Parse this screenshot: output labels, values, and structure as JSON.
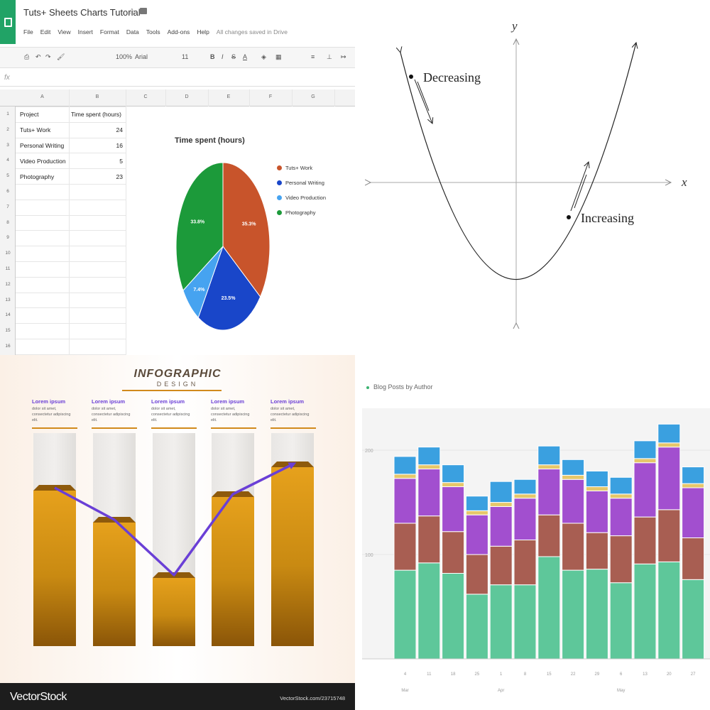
{
  "spreadsheet": {
    "title": "Tuts+ Sheets Charts Tutorial",
    "menu": [
      "File",
      "Edit",
      "View",
      "Insert",
      "Format",
      "Data",
      "Tools",
      "Add-ons",
      "Help"
    ],
    "saved_status": "All changes saved in Drive",
    "toolbar": {
      "zoom": "100%",
      "font": "Arial",
      "size": "11",
      "bold": "B",
      "italic": "I",
      "strike": "S",
      "text_color": "A"
    },
    "fx_label": "fx",
    "columns": [
      "A",
      "B",
      "C",
      "D",
      "E",
      "F",
      "G"
    ],
    "rows": [
      "1",
      "2",
      "3",
      "4",
      "5",
      "6",
      "7",
      "8",
      "9",
      "10",
      "11",
      "12",
      "13",
      "14",
      "15",
      "16"
    ],
    "headers": {
      "project": "Project",
      "time": "Time spent (hours)"
    },
    "data_rows": [
      {
        "project": "Tuts+ Work",
        "hours": "24"
      },
      {
        "project": "Personal Writing",
        "hours": "16"
      },
      {
        "project": "Video Production",
        "hours": "5"
      },
      {
        "project": "Photography",
        "hours": "23"
      }
    ]
  },
  "chart_data": [
    {
      "type": "pie",
      "title": "Time spent (hours)",
      "labels": [
        "Tuts+ Work",
        "Personal Writing",
        "Video Production",
        "Photography"
      ],
      "values": [
        24,
        16,
        5,
        23
      ],
      "slice_labels": [
        "35.3%",
        "23.5%",
        "7.4%",
        "33.8%"
      ],
      "colors": [
        "#c8542b",
        "#1946c9",
        "#46a3f0",
        "#1c9a3a"
      ],
      "legend_position": "right"
    },
    {
      "type": "line",
      "axis_labels": {
        "x": "x",
        "y": "y"
      },
      "annotations": {
        "left": "Decreasing",
        "right": "Increasing"
      },
      "curve": "parabola"
    },
    {
      "type": "bar",
      "title": "INFOGRAPHIC",
      "subtitle": "DESIGN",
      "values": [
        73,
        58,
        32,
        70,
        84
      ],
      "ylim": [
        0,
        100
      ],
      "column_heading": "Lorem ipsum",
      "column_text": "dolor sit amet, consectetur adipiscing elit.",
      "line_color": "#6a3fd6",
      "bar_color": "#c98a12"
    },
    {
      "type": "bar",
      "stacked": true,
      "title": "Blog Posts by Author",
      "ylim": [
        0,
        230
      ],
      "y_ticks": [
        "200",
        "100"
      ],
      "x_ticks": [
        "4",
        "11",
        "18",
        "25",
        "1",
        "8",
        "15",
        "22",
        "29",
        "6",
        "13",
        "20",
        "27"
      ],
      "month_labels": [
        "Mar",
        "Apr",
        "May"
      ],
      "series_colors": [
        "#5ec79a",
        "#a85e52",
        "#a24fcf",
        "#e6c76a",
        "#3aa0e0"
      ],
      "bars": [
        [
          85,
          45,
          43,
          4,
          17
        ],
        [
          92,
          45,
          45,
          4,
          17
        ],
        [
          82,
          40,
          43,
          4,
          17
        ],
        [
          62,
          38,
          38,
          4,
          14
        ],
        [
          71,
          37,
          38,
          4,
          20
        ],
        [
          71,
          43,
          40,
          4,
          14
        ],
        [
          98,
          40,
          44,
          4,
          18
        ],
        [
          85,
          45,
          42,
          4,
          15
        ],
        [
          86,
          35,
          40,
          4,
          15
        ],
        [
          73,
          45,
          36,
          4,
          16
        ],
        [
          91,
          45,
          52,
          4,
          17
        ],
        [
          93,
          50,
          60,
          4,
          18
        ],
        [
          76,
          40,
          48,
          4,
          16
        ]
      ]
    }
  ],
  "watermark": {
    "logo": "VectorStock",
    "url": "VectorStock.com/23715748"
  }
}
